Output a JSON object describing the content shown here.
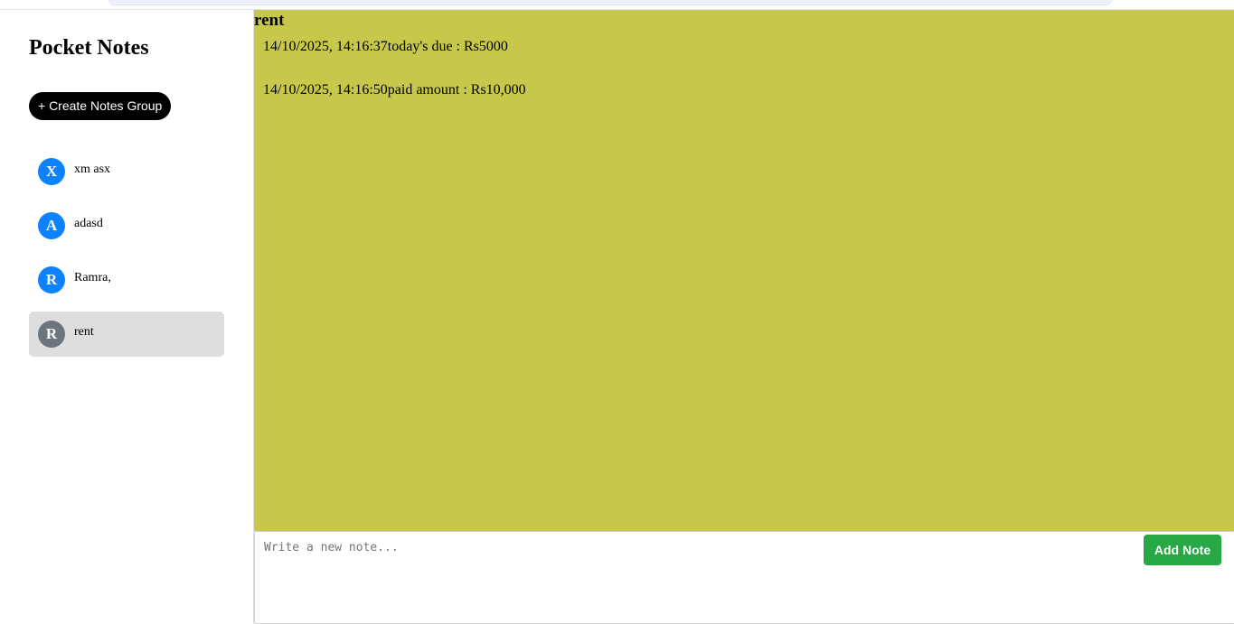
{
  "app": {
    "title": "Pocket Notes",
    "create_button_label": "+ Create Notes Group"
  },
  "groups": [
    {
      "initial": "X",
      "name": "xm asx",
      "active": false,
      "color": "#0d82ff"
    },
    {
      "initial": "A",
      "name": "adasd",
      "active": false,
      "color": "#0d82ff"
    },
    {
      "initial": "R",
      "name": "Ramra,",
      "active": false,
      "color": "#0d82ff"
    },
    {
      "initial": "R",
      "name": "rent",
      "active": true,
      "color": "#6c757d"
    }
  ],
  "active_group": {
    "title": "rent",
    "background_color": "#c7c74b",
    "notes": [
      "14/10/2025, 14:16:37today's due : Rs5000",
      "14/10/2025, 14:16:50paid amount : Rs10,000"
    ]
  },
  "composer": {
    "placeholder": "Write a new note...",
    "value": "",
    "add_button_label": "Add Note",
    "add_button_color": "#28a745"
  }
}
